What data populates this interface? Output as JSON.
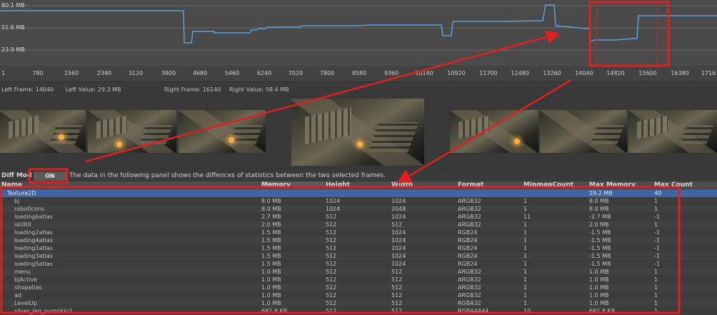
{
  "graph": {
    "y_labels": [
      "80.1 MB",
      "51.6 MB",
      "23.9 MB"
    ],
    "x_ticks": [
      "1",
      "780",
      "1560",
      "2340",
      "3120",
      "3900",
      "4680",
      "5460",
      "6240",
      "7020",
      "7800",
      "8580",
      "9360",
      "10140",
      "10920",
      "11700",
      "12480",
      "13260",
      "14040",
      "14820",
      "15600",
      "16380",
      "1716"
    ],
    "line_color": "#5aa0dc"
  },
  "frame_info": {
    "left_frame": "Left Frame: 14640",
    "left_value": "Left Value: 29.3 MB",
    "right_frame": "Right Frame: 16140",
    "right_value": "Right Value: 58.4 MB"
  },
  "diff": {
    "label": "Diff Mod",
    "toggle": "ON",
    "note": "The data in the following panel shows the diffences of statistics between the two selected frames."
  },
  "table": {
    "columns": [
      "Name",
      "Memory",
      "Height",
      "Width",
      "Format",
      "MipmapCount",
      "Max Memory",
      "Max Count"
    ],
    "group": {
      "name": "Texture2D",
      "max_memory": "29.2 MB",
      "max_count": "40"
    },
    "rows": [
      {
        "name": "bj",
        "memory": "8.0 MB",
        "height": "1024",
        "width": "1024",
        "format": "ARGB32",
        "mip": "1",
        "max_memory": "8.0 MB",
        "max_count": "1"
      },
      {
        "name": "robotIcons",
        "memory": "8.0 MB",
        "height": "1024",
        "width": "2048",
        "format": "ARGB32",
        "mip": "1",
        "max_memory": "8.0 MB",
        "max_count": "1"
      },
      {
        "name": "loading6atlas",
        "memory": "2.7 MB",
        "height": "512",
        "width": "1024",
        "format": "ARGB32",
        "mip": "11",
        "max_memory": "-2.7 MB",
        "max_count": "-1"
      },
      {
        "name": "skillUI",
        "memory": "2.0 MB",
        "height": "512",
        "width": "512",
        "format": "ARGB32",
        "mip": "1",
        "max_memory": "2.0 MB",
        "max_count": "1"
      },
      {
        "name": "loading2atlas",
        "memory": "1.5 MB",
        "height": "512",
        "width": "1024",
        "format": "RGB24",
        "mip": "1",
        "max_memory": "-1.5 MB",
        "max_count": "-1"
      },
      {
        "name": "loading4atlas",
        "memory": "1.5 MB",
        "height": "512",
        "width": "1024",
        "format": "RGB24",
        "mip": "1",
        "max_memory": "-1.5 MB",
        "max_count": "-1"
      },
      {
        "name": "loading1atlas",
        "memory": "1.5 MB",
        "height": "512",
        "width": "1024",
        "format": "RGB24",
        "mip": "1",
        "max_memory": "-1.5 MB",
        "max_count": "-1"
      },
      {
        "name": "loading3atlas",
        "memory": "1.5 MB",
        "height": "512",
        "width": "1024",
        "format": "RGB24",
        "mip": "1",
        "max_memory": "-1.5 MB",
        "max_count": "-1"
      },
      {
        "name": "loading5atlas",
        "memory": "1.5 MB",
        "height": "512",
        "width": "1024",
        "format": "RGB24",
        "mip": "1",
        "max_memory": "-1.5 MB",
        "max_count": "-1"
      },
      {
        "name": "menu",
        "memory": "1.0 MB",
        "height": "512",
        "width": "512",
        "format": "ARGB32",
        "mip": "1",
        "max_memory": "1.0 MB",
        "max_count": "1"
      },
      {
        "name": "bjActive",
        "memory": "1.0 MB",
        "height": "512",
        "width": "512",
        "format": "ARGB32",
        "mip": "1",
        "max_memory": "1.0 MB",
        "max_count": "1"
      },
      {
        "name": "shopatlas",
        "memory": "1.0 MB",
        "height": "512",
        "width": "512",
        "format": "ARGB32",
        "mip": "1",
        "max_memory": "1.0 MB",
        "max_count": "1"
      },
      {
        "name": "ad",
        "memory": "1.0 MB",
        "height": "512",
        "width": "512",
        "format": "ARGB32",
        "mip": "1",
        "max_memory": "1.0 MB",
        "max_count": "1"
      },
      {
        "name": "LevelUp",
        "memory": "1.0 MB",
        "height": "512",
        "width": "512",
        "format": "RGBA32",
        "mip": "1",
        "max_memory": "1.0 MB",
        "max_count": "1"
      },
      {
        "name": "silver_leg_pumpkin1",
        "memory": "682.8 KB",
        "height": "512",
        "width": "512",
        "format": "RGBA4444",
        "mip": "10",
        "max_memory": "682.8 KB",
        "max_count": "1"
      }
    ]
  },
  "colors": {
    "annotation": "#e02020",
    "selection": "#3e65a8"
  }
}
